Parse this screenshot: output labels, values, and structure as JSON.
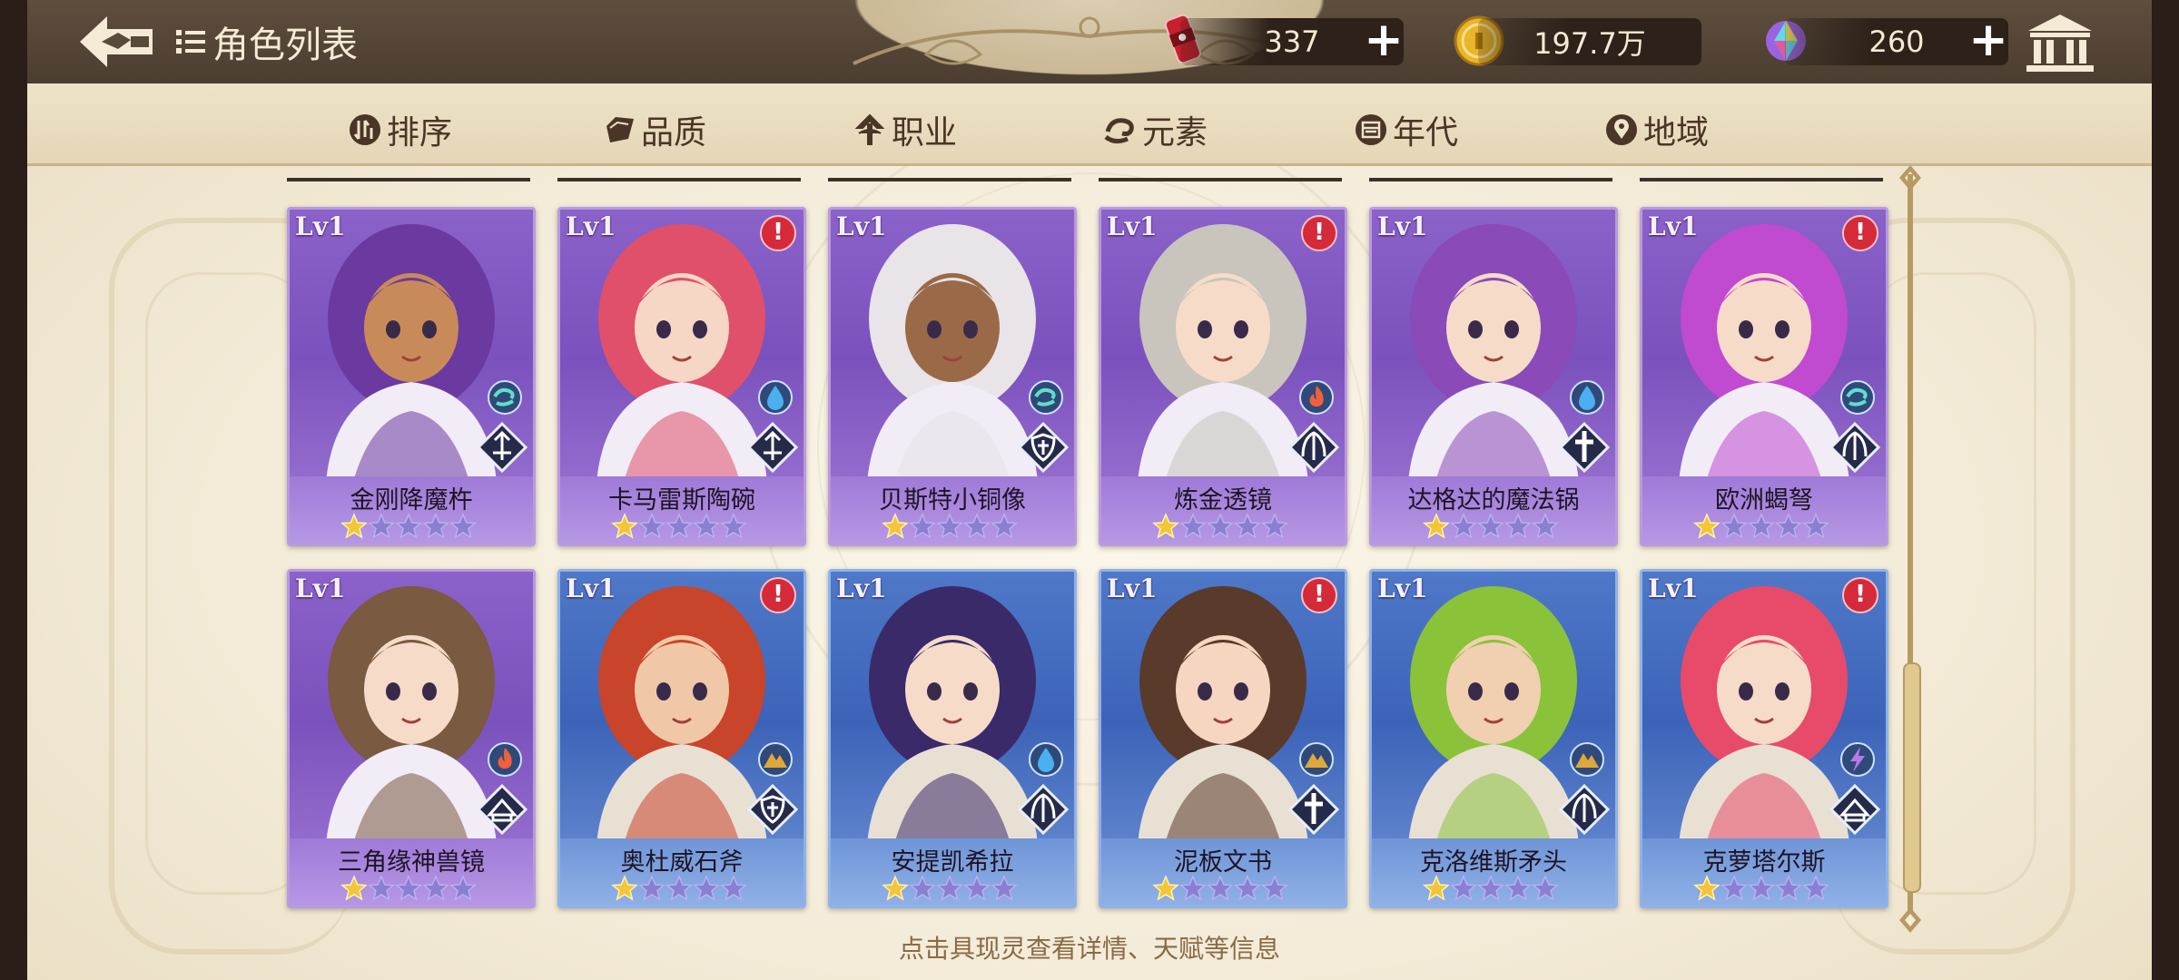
{
  "header": {
    "title": "角色列表",
    "resources": [
      {
        "name": "energy-drink",
        "value": "337"
      },
      {
        "name": "gold",
        "value": "197.7万"
      },
      {
        "name": "crystal",
        "value": "260"
      }
    ],
    "plus_label": "+"
  },
  "filters": [
    "排序",
    "品质",
    "职业",
    "元素",
    "年代",
    "地域"
  ],
  "cards": [
    {
      "level": "Lv1",
      "name": "金刚降魔杵",
      "rarity": "purple",
      "alert": false,
      "element": "wind",
      "class": "sword",
      "stars": 1,
      "max_stars": 5
    },
    {
      "level": "Lv1",
      "name": "卡马雷斯陶碗",
      "rarity": "purple",
      "alert": true,
      "element": "water",
      "class": "sword",
      "stars": 1,
      "max_stars": 5
    },
    {
      "level": "Lv1",
      "name": "贝斯特小铜像",
      "rarity": "purple",
      "alert": false,
      "element": "wind",
      "class": "shield",
      "stars": 1,
      "max_stars": 5
    },
    {
      "level": "Lv1",
      "name": "炼金透镜",
      "rarity": "purple",
      "alert": true,
      "element": "fire",
      "class": "bow",
      "stars": 1,
      "max_stars": 5
    },
    {
      "level": "Lv1",
      "name": "达格达的魔法锅",
      "rarity": "purple",
      "alert": false,
      "element": "water",
      "class": "cross",
      "stars": 1,
      "max_stars": 5
    },
    {
      "level": "Lv1",
      "name": "欧洲蝎弩",
      "rarity": "purple",
      "alert": true,
      "element": "wind",
      "class": "bow",
      "stars": 1,
      "max_stars": 5
    },
    {
      "level": "Lv1",
      "name": "三角缘神兽镜",
      "rarity": "purple",
      "alert": false,
      "element": "fire",
      "class": "book",
      "stars": 1,
      "max_stars": 5
    },
    {
      "level": "Lv1",
      "name": "奥杜威石斧",
      "rarity": "blue",
      "alert": true,
      "element": "earth",
      "class": "shield",
      "stars": 1,
      "max_stars": 5
    },
    {
      "level": "Lv1",
      "name": "安提凯希拉",
      "rarity": "blue",
      "alert": false,
      "element": "water",
      "class": "bow",
      "stars": 1,
      "max_stars": 5
    },
    {
      "level": "Lv1",
      "name": "泥板文书",
      "rarity": "blue",
      "alert": true,
      "element": "earth",
      "class": "cross",
      "stars": 1,
      "max_stars": 5
    },
    {
      "level": "Lv1",
      "name": "克洛维斯矛头",
      "rarity": "blue",
      "alert": false,
      "element": "earth",
      "class": "bow",
      "stars": 1,
      "max_stars": 5
    },
    {
      "level": "Lv1",
      "name": "克萝塔尔斯",
      "rarity": "blue",
      "alert": true,
      "element": "lightning",
      "class": "book",
      "stars": 1,
      "max_stars": 5
    }
  ],
  "hint": "点击具现灵查看详情、天赋等信息",
  "colors": {
    "purple_card": "#7b51bd",
    "blue_card": "#3c63b8",
    "alert_red": "#d42a3a",
    "star_gold": "#f2c53a",
    "star_empty": "#8a7fd0"
  }
}
